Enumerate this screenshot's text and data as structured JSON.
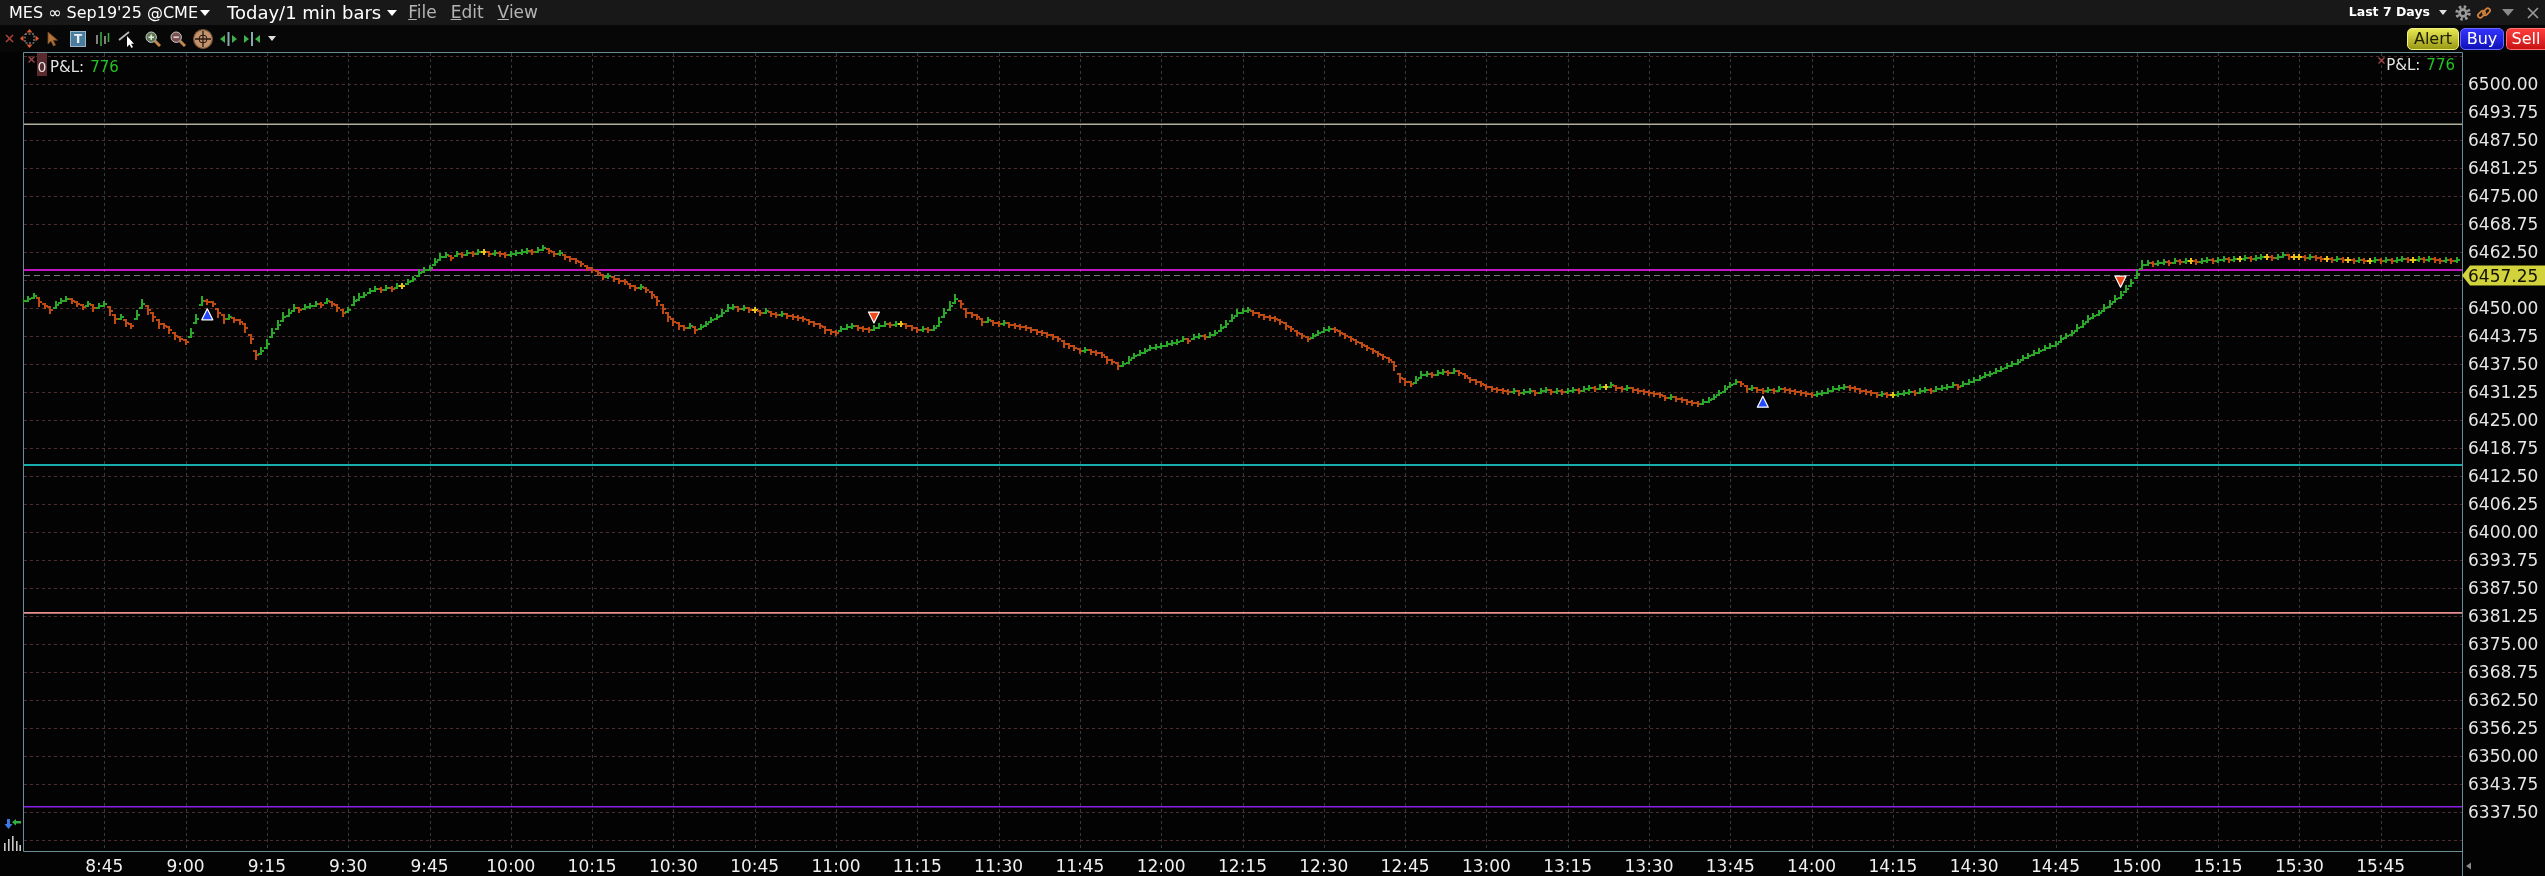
{
  "title_bar": {
    "instrument": "MES ∞ Sep19'25 @CME",
    "bar_setting": "Today/1 min bars",
    "menus": [
      "File",
      "Edit",
      "View"
    ],
    "date_range": "Last 7 Days"
  },
  "toolbar": {
    "text_tool": "T",
    "order_buttons": [
      {
        "kind": "alert",
        "label": "Alert"
      },
      {
        "kind": "buy",
        "label": "Buy"
      },
      {
        "kind": "sell",
        "label": "Sell"
      }
    ]
  },
  "chart": {
    "legend_left": {
      "badge": "0",
      "label": "P&L:",
      "value": "776"
    },
    "legend_right": {
      "label": "P&L:",
      "value": "776"
    },
    "chart_data": {
      "type": "scatter",
      "grid": true,
      "xlim": [
        510,
        960
      ],
      "ylim": [
        6328.875,
        6507.125
      ],
      "x": [
        510,
        511,
        512,
        513,
        514,
        515,
        516,
        517,
        518,
        519,
        520,
        521,
        522,
        523,
        524,
        525,
        526,
        527,
        528,
        529,
        530,
        531,
        532,
        533,
        534,
        535,
        536,
        537,
        538,
        539,
        540,
        541,
        542,
        543,
        544,
        545,
        546,
        547,
        548,
        549,
        550,
        551,
        552,
        553,
        554,
        555,
        556,
        557,
        558,
        559,
        560,
        561,
        562,
        563,
        564,
        565,
        566,
        567,
        568,
        569,
        570,
        571,
        572,
        573,
        574,
        575,
        576,
        577,
        578,
        579,
        580,
        581,
        582,
        583,
        584,
        585,
        586,
        587,
        588,
        589,
        590,
        591,
        592,
        593,
        594,
        595,
        596,
        597,
        598,
        599,
        600,
        601,
        602,
        603,
        604,
        605,
        606,
        607,
        608,
        609,
        610,
        611,
        612,
        613,
        614,
        615,
        616,
        617,
        618,
        619,
        620,
        621,
        622,
        623,
        624,
        625,
        626,
        627,
        628,
        629,
        630,
        631,
        632,
        633,
        634,
        635,
        636,
        637,
        638,
        639,
        640,
        641,
        642,
        643,
        644,
        645,
        646,
        647,
        648,
        649,
        650,
        651,
        652,
        653,
        654,
        655,
        656,
        657,
        658,
        659,
        660,
        661,
        662,
        663,
        664,
        665,
        666,
        667,
        668,
        669,
        670,
        671,
        672,
        673,
        674,
        675,
        676,
        677,
        678,
        679,
        680,
        681,
        682,
        683,
        684,
        685,
        686,
        687,
        688,
        689,
        690,
        691,
        692,
        693,
        694,
        695,
        696,
        697,
        698,
        699,
        700,
        701,
        702,
        703,
        704,
        705,
        706,
        707,
        708,
        709,
        710,
        711,
        712,
        713,
        714,
        715,
        716,
        717,
        718,
        719,
        720,
        721,
        722,
        723,
        724,
        725,
        726,
        727,
        728,
        729,
        730,
        731,
        732,
        733,
        734,
        735,
        736,
        737,
        738,
        739,
        740,
        741,
        742,
        743,
        744,
        745,
        746,
        747,
        748,
        749,
        750,
        751,
        752,
        753,
        754,
        755,
        756,
        757,
        758,
        759,
        760,
        761,
        762,
        763,
        764,
        765,
        766,
        767,
        768,
        769,
        770,
        771,
        772,
        773,
        774,
        775,
        776,
        777,
        778,
        779,
        780,
        781,
        782,
        783,
        784,
        785,
        786,
        787,
        788,
        789,
        790,
        791,
        792,
        793,
        794,
        795,
        796,
        797,
        798,
        799,
        800,
        801,
        802,
        803,
        804,
        805,
        806,
        807,
        808,
        809,
        810,
        811,
        812,
        813,
        814,
        815,
        816,
        817,
        818,
        819,
        820,
        821,
        822,
        823,
        824,
        825,
        826,
        827,
        828,
        829,
        830,
        831,
        832,
        833,
        834,
        835,
        836,
        837,
        838,
        839,
        840,
        841,
        842,
        843,
        844,
        845,
        846,
        847,
        848,
        849,
        850,
        851,
        852,
        853,
        854,
        855,
        856,
        857,
        858,
        859,
        860,
        861,
        862,
        863,
        864,
        865,
        866,
        867,
        868,
        869,
        870,
        871,
        872,
        873,
        874,
        875,
        876,
        877,
        878,
        879,
        880,
        881,
        882,
        883,
        884,
        885,
        886,
        887,
        888,
        889,
        890,
        891,
        892,
        893,
        894,
        895,
        896,
        897,
        898,
        899,
        900,
        901,
        902,
        903,
        904,
        905,
        906,
        907,
        908,
        909,
        910,
        911,
        912,
        913,
        914,
        915,
        916,
        917,
        918,
        919,
        920,
        921,
        922,
        923,
        924,
        925,
        926,
        927,
        928,
        929,
        930,
        931,
        932,
        933,
        934,
        935,
        936,
        937,
        938,
        939,
        940,
        941,
        942,
        943,
        944,
        945,
        946,
        947,
        948,
        949,
        950,
        951,
        952,
        953,
        954,
        955,
        956,
        957,
        958,
        959
      ],
      "series": [
        {
          "values": [
            6451.5,
            6452,
            6452.75,
            6451.25,
            6450.5,
            6449.5,
            6450.75,
            6451.5,
            6452,
            6451.5,
            6451,
            6450.25,
            6451,
            6450,
            6450.5,
            6451,
            6449.25,
            6447.5,
            6448,
            6446.75,
            6446,
            6448.5,
            6451,
            6449.5,
            6448,
            6446.5,
            6446,
            6445,
            6443.75,
            6443,
            6442.5,
            6444.5,
            6447.5,
            6451.5,
            6451.25,
            6451,
            6449,
            6447.5,
            6448,
            6447.25,
            6447,
            6445.5,
            6443,
            6439.5,
            6440.5,
            6442,
            6444.5,
            6446.25,
            6448,
            6449,
            6450,
            6449.5,
            6450.25,
            6450.5,
            6451,
            6450.75,
            6451.5,
            6451,
            6450,
            6449,
            6449.5,
            6451.5,
            6452.5,
            6453,
            6453.75,
            6454.25,
            6454,
            6454.5,
            6454.25,
            6455,
            6455,
            6455.75,
            6456.5,
            6457.75,
            6458.5,
            6459,
            6460.25,
            6461.5,
            6461.75,
            6461.25,
            6462,
            6461.75,
            6462.25,
            6462,
            6462.5,
            6462.5,
            6462,
            6462.25,
            6462,
            6461.75,
            6462,
            6462.25,
            6462.5,
            6462.75,
            6462.5,
            6463,
            6463.5,
            6462.75,
            6462,
            6462.25,
            6461.5,
            6461,
            6460.5,
            6459.75,
            6459,
            6458.5,
            6457.75,
            6457,
            6457.25,
            6456.5,
            6456,
            6455.75,
            6455,
            6454.5,
            6454.75,
            6454,
            6453,
            6451.5,
            6449.75,
            6448,
            6447,
            6446,
            6445.5,
            6446,
            6445,
            6445.75,
            6446.5,
            6447.25,
            6448,
            6449,
            6450,
            6450.25,
            6449.75,
            6450,
            6449.5,
            6449.5,
            6449,
            6449.25,
            6448.75,
            6448.5,
            6448.75,
            6448.25,
            6448,
            6447.75,
            6447.5,
            6447,
            6446.5,
            6446,
            6445,
            6444.75,
            6444.5,
            6445.25,
            6445.75,
            6446,
            6445.5,
            6445.25,
            6445,
            6445.5,
            6446,
            6446.5,
            6446.25,
            6446.5,
            6446.5,
            6446,
            6445.5,
            6445,
            6445.25,
            6445,
            6445.5,
            6447,
            6449,
            6450.5,
            6452,
            6451,
            6449,
            6448.5,
            6448,
            6447,
            6447.25,
            6446.75,
            6446.5,
            6446.75,
            6446.25,
            6446,
            6445.75,
            6445.5,
            6445,
            6444.75,
            6444.5,
            6444,
            6443.5,
            6443,
            6442,
            6441.5,
            6441,
            6440.5,
            6440.75,
            6440.25,
            6440,
            6439.5,
            6438.5,
            6438,
            6437,
            6437.5,
            6438.5,
            6439.25,
            6440,
            6440.5,
            6441,
            6441.25,
            6441.5,
            6442,
            6442.25,
            6442.5,
            6443,
            6442.75,
            6443.5,
            6443.75,
            6443.5,
            6444,
            6444.5,
            6445.5,
            6446.5,
            6447.75,
            6449,
            6449.25,
            6449.5,
            6449,
            6448.5,
            6448,
            6447.75,
            6447.5,
            6447,
            6446,
            6445.25,
            6444.5,
            6443.75,
            6443,
            6443.75,
            6444.5,
            6445,
            6445.25,
            6445,
            6444.5,
            6443.75,
            6443,
            6442.5,
            6441.75,
            6441,
            6440.5,
            6439.75,
            6439,
            6438.5,
            6437,
            6434.5,
            6433.5,
            6433,
            6434,
            6435,
            6435.25,
            6435,
            6435.5,
            6435.75,
            6435.5,
            6436,
            6435.5,
            6434.75,
            6434,
            6433.5,
            6433,
            6432.5,
            6432,
            6431.75,
            6431.5,
            6431.25,
            6431.5,
            6431,
            6431.25,
            6431.5,
            6431,
            6431.5,
            6431.75,
            6431.25,
            6431.5,
            6431.25,
            6431.5,
            6431.75,
            6431.5,
            6432,
            6432.25,
            6432,
            6432.5,
            6432.5,
            6432.75,
            6432.25,
            6432,
            6432.25,
            6431.75,
            6431.5,
            6431.25,
            6431,
            6430.75,
            6430.5,
            6430,
            6430.25,
            6429.75,
            6429.5,
            6429,
            6428.75,
            6428.5,
            6429,
            6429.5,
            6430.25,
            6431,
            6432,
            6432.75,
            6433.5,
            6433,
            6432,
            6432.25,
            6431.75,
            6431.5,
            6431.75,
            6431.5,
            6432,
            6431.75,
            6431.5,
            6431.25,
            6431,
            6430.75,
            6430.5,
            6430.75,
            6431,
            6431.5,
            6432,
            6432.25,
            6432.5,
            6432.25,
            6432,
            6431.5,
            6431.25,
            6431,
            6430.5,
            6430.75,
            6430.5,
            6430.5,
            6430.75,
            6431,
            6431.25,
            6431,
            6431.5,
            6431.75,
            6431.5,
            6432,
            6432.25,
            6432.5,
            6432.75,
            6432.5,
            6433,
            6433.5,
            6434,
            6434.5,
            6435,
            6435.25,
            6436,
            6436.5,
            6437,
            6437.5,
            6438,
            6438.75,
            6439.25,
            6440,
            6440.5,
            6441,
            6441.5,
            6442,
            6443,
            6443.75,
            6444.5,
            6445.5,
            6446.5,
            6447.5,
            6448.25,
            6449,
            6450,
            6451,
            6452,
            6453,
            6454.25,
            6455.5,
            6457.5,
            6459.5,
            6460,
            6459.75,
            6460,
            6460.25,
            6460,
            6460.5,
            6460.25,
            6460.5,
            6460.5,
            6460.25,
            6460.5,
            6460.75,
            6460.5,
            6460.75,
            6461,
            6460.75,
            6461,
            6461,
            6461.25,
            6461,
            6461.25,
            6461.5,
            6461.5,
            6461.25,
            6461.5,
            6461.75,
            6461.5,
            6461.5,
            6461.5,
            6461.25,
            6461.5,
            6461.25,
            6461,
            6461,
            6460.75,
            6461,
            6460.75,
            6460.75,
            6460.5,
            6460.75,
            6460.5,
            6460.5,
            6460.75,
            6460.5,
            6460.75,
            6460.5,
            6460.75,
            6461,
            6460.75,
            6460.75,
            6461,
            6460.75,
            6461,
            6460.75,
            6460.5,
            6460.75,
            6460.5,
            6460.75
          ],
          "colors": [
            "#2aa82a",
            "#2aa82a",
            "#2aa82a",
            "#c04a14",
            "#c04a14",
            "#c04a14",
            "#2aa82a",
            "#2aa82a",
            "#2aa82a",
            "#c04a14",
            "#c04a14",
            "#c04a14",
            "#2aa82a",
            "#c04a14",
            "#2aa82a",
            "#2aa82a",
            "#c04a14",
            "#c04a14",
            "#2aa82a",
            "#c04a14",
            "#c04a14",
            "#2aa82a",
            "#2aa82a",
            "#c04a14",
            "#c04a14",
            "#c04a14",
            "#c04a14",
            "#c04a14",
            "#c04a14",
            "#c04a14",
            "#c04a14",
            "#2aa82a",
            "#2aa82a",
            "#2aa82a",
            "#c04a14",
            "#c04a14",
            "#c04a14",
            "#c04a14",
            "#2aa82a",
            "#c04a14",
            "#c04a14",
            "#c04a14",
            "#c04a14",
            "#c04a14",
            "#2aa82a",
            "#2aa82a",
            "#2aa82a",
            "#2aa82a",
            "#2aa82a",
            "#2aa82a",
            "#2aa82a",
            "#c04a14",
            "#2aa82a",
            "#2aa82a",
            "#2aa82a",
            "#c04a14",
            "#2aa82a",
            "#c04a14",
            "#c04a14",
            "#c04a14",
            "#2aa82a",
            "#2aa82a",
            "#2aa82a",
            "#2aa82a",
            "#2aa82a",
            "#2aa82a",
            "#c04a14",
            "#2aa82a",
            "#c04a14",
            "#2aa82a",
            "#e8c418",
            "#2aa82a",
            "#2aa82a",
            "#2aa82a",
            "#2aa82a",
            "#2aa82a",
            "#2aa82a",
            "#2aa82a",
            "#2aa82a",
            "#c04a14",
            "#2aa82a",
            "#c04a14",
            "#2aa82a",
            "#c04a14",
            "#2aa82a",
            "#e8c418",
            "#c04a14",
            "#2aa82a",
            "#c04a14",
            "#c04a14",
            "#2aa82a",
            "#2aa82a",
            "#2aa82a",
            "#2aa82a",
            "#c04a14",
            "#2aa82a",
            "#2aa82a",
            "#c04a14",
            "#c04a14",
            "#2aa82a",
            "#c04a14",
            "#c04a14",
            "#c04a14",
            "#c04a14",
            "#c04a14",
            "#c04a14",
            "#c04a14",
            "#c04a14",
            "#2aa82a",
            "#c04a14",
            "#c04a14",
            "#c04a14",
            "#c04a14",
            "#c04a14",
            "#2aa82a",
            "#c04a14",
            "#c04a14",
            "#c04a14",
            "#c04a14",
            "#c04a14",
            "#c04a14",
            "#c04a14",
            "#c04a14",
            "#2aa82a",
            "#c04a14",
            "#2aa82a",
            "#2aa82a",
            "#2aa82a",
            "#2aa82a",
            "#2aa82a",
            "#2aa82a",
            "#2aa82a",
            "#c04a14",
            "#2aa82a",
            "#c04a14",
            "#e8c418",
            "#c04a14",
            "#2aa82a",
            "#c04a14",
            "#c04a14",
            "#2aa82a",
            "#c04a14",
            "#c04a14",
            "#c04a14",
            "#c04a14",
            "#c04a14",
            "#c04a14",
            "#c04a14",
            "#c04a14",
            "#c04a14",
            "#c04a14",
            "#2aa82a",
            "#2aa82a",
            "#2aa82a",
            "#c04a14",
            "#c04a14",
            "#c04a14",
            "#2aa82a",
            "#2aa82a",
            "#2aa82a",
            "#c04a14",
            "#2aa82a",
            "#e8c418",
            "#c04a14",
            "#c04a14",
            "#c04a14",
            "#2aa82a",
            "#c04a14",
            "#2aa82a",
            "#2aa82a",
            "#2aa82a",
            "#2aa82a",
            "#2aa82a",
            "#c04a14",
            "#c04a14",
            "#c04a14",
            "#c04a14",
            "#c04a14",
            "#2aa82a",
            "#c04a14",
            "#c04a14",
            "#2aa82a",
            "#c04a14",
            "#c04a14",
            "#c04a14",
            "#c04a14",
            "#c04a14",
            "#c04a14",
            "#c04a14",
            "#c04a14",
            "#c04a14",
            "#c04a14",
            "#c04a14",
            "#c04a14",
            "#c04a14",
            "#c04a14",
            "#2aa82a",
            "#c04a14",
            "#c04a14",
            "#c04a14",
            "#c04a14",
            "#c04a14",
            "#c04a14",
            "#2aa82a",
            "#2aa82a",
            "#2aa82a",
            "#2aa82a",
            "#2aa82a",
            "#2aa82a",
            "#2aa82a",
            "#2aa82a",
            "#2aa82a",
            "#2aa82a",
            "#2aa82a",
            "#2aa82a",
            "#c04a14",
            "#2aa82a",
            "#2aa82a",
            "#c04a14",
            "#2aa82a",
            "#2aa82a",
            "#2aa82a",
            "#2aa82a",
            "#2aa82a",
            "#2aa82a",
            "#2aa82a",
            "#2aa82a",
            "#c04a14",
            "#c04a14",
            "#c04a14",
            "#c04a14",
            "#c04a14",
            "#c04a14",
            "#c04a14",
            "#c04a14",
            "#c04a14",
            "#c04a14",
            "#c04a14",
            "#2aa82a",
            "#2aa82a",
            "#2aa82a",
            "#2aa82a",
            "#c04a14",
            "#c04a14",
            "#c04a14",
            "#c04a14",
            "#c04a14",
            "#c04a14",
            "#c04a14",
            "#c04a14",
            "#c04a14",
            "#c04a14",
            "#c04a14",
            "#c04a14",
            "#c04a14",
            "#c04a14",
            "#c04a14",
            "#2aa82a",
            "#2aa82a",
            "#2aa82a",
            "#c04a14",
            "#2aa82a",
            "#2aa82a",
            "#c04a14",
            "#2aa82a",
            "#c04a14",
            "#c04a14",
            "#c04a14",
            "#c04a14",
            "#c04a14",
            "#c04a14",
            "#c04a14",
            "#c04a14",
            "#c04a14",
            "#c04a14",
            "#2aa82a",
            "#c04a14",
            "#2aa82a",
            "#2aa82a",
            "#c04a14",
            "#2aa82a",
            "#2aa82a",
            "#c04a14",
            "#2aa82a",
            "#c04a14",
            "#2aa82a",
            "#2aa82a",
            "#c04a14",
            "#2aa82a",
            "#2aa82a",
            "#c04a14",
            "#2aa82a",
            "#e8c418",
            "#2aa82a",
            "#c04a14",
            "#c04a14",
            "#2aa82a",
            "#c04a14",
            "#c04a14",
            "#c04a14",
            "#c04a14",
            "#c04a14",
            "#c04a14",
            "#c04a14",
            "#2aa82a",
            "#c04a14",
            "#c04a14",
            "#c04a14",
            "#c04a14",
            "#c04a14",
            "#2aa82a",
            "#2aa82a",
            "#2aa82a",
            "#2aa82a",
            "#2aa82a",
            "#2aa82a",
            "#2aa82a",
            "#c04a14",
            "#c04a14",
            "#2aa82a",
            "#c04a14",
            "#c04a14",
            "#2aa82a",
            "#c04a14",
            "#2aa82a",
            "#c04a14",
            "#c04a14",
            "#c04a14",
            "#c04a14",
            "#c04a14",
            "#c04a14",
            "#2aa82a",
            "#2aa82a",
            "#2aa82a",
            "#2aa82a",
            "#2aa82a",
            "#2aa82a",
            "#c04a14",
            "#c04a14",
            "#c04a14",
            "#c04a14",
            "#c04a14",
            "#c04a14",
            "#2aa82a",
            "#c04a14",
            "#e8c418",
            "#2aa82a",
            "#2aa82a",
            "#2aa82a",
            "#c04a14",
            "#2aa82a",
            "#2aa82a",
            "#c04a14",
            "#2aa82a",
            "#2aa82a",
            "#2aa82a",
            "#2aa82a",
            "#c04a14",
            "#2aa82a",
            "#2aa82a",
            "#2aa82a",
            "#2aa82a",
            "#2aa82a",
            "#2aa82a",
            "#2aa82a",
            "#2aa82a",
            "#2aa82a",
            "#2aa82a",
            "#2aa82a",
            "#2aa82a",
            "#2aa82a",
            "#2aa82a",
            "#2aa82a",
            "#2aa82a",
            "#2aa82a",
            "#2aa82a",
            "#2aa82a",
            "#2aa82a",
            "#2aa82a",
            "#2aa82a",
            "#2aa82a",
            "#2aa82a",
            "#2aa82a",
            "#2aa82a",
            "#2aa82a",
            "#2aa82a",
            "#2aa82a",
            "#2aa82a",
            "#2aa82a",
            "#2aa82a",
            "#2aa82a",
            "#2aa82a",
            "#2aa82a",
            "#c04a14",
            "#2aa82a",
            "#2aa82a",
            "#c04a14",
            "#2aa82a",
            "#c04a14",
            "#2aa82a",
            "#e8c418",
            "#c04a14",
            "#2aa82a",
            "#2aa82a",
            "#c04a14",
            "#2aa82a",
            "#2aa82a",
            "#c04a14",
            "#2aa82a",
            "#e8c418",
            "#2aa82a",
            "#c04a14",
            "#2aa82a",
            "#2aa82a",
            "#e8c418",
            "#c04a14",
            "#2aa82a",
            "#2aa82a",
            "#c04a14",
            "#e8c418",
            "#e8c418",
            "#c04a14",
            "#2aa82a",
            "#c04a14",
            "#c04a14",
            "#e8c418",
            "#c04a14",
            "#2aa82a",
            "#c04a14",
            "#e8c418",
            "#c04a14",
            "#2aa82a",
            "#c04a14",
            "#e8c418",
            "#2aa82a",
            "#c04a14",
            "#2aa82a",
            "#c04a14",
            "#2aa82a",
            "#2aa82a",
            "#c04a14",
            "#e8c418",
            "#2aa82a",
            "#c04a14",
            "#2aa82a",
            "#c04a14",
            "#c04a14",
            "#2aa82a",
            "#c04a14",
            "#2aa82a"
          ]
        },
        {
          "marker": "triangle-up",
          "color": "#2448ff",
          "x": [
            544,
            831
          ],
          "values": [
            6448.5,
            6429
          ]
        },
        {
          "marker": "triangle-down",
          "color": "#f04a1c",
          "x": [
            667,
            897
          ],
          "values": [
            6448,
            6456
          ]
        }
      ],
      "xticks": [
        {
          "value": 525,
          "label": "8:45"
        },
        {
          "value": 540,
          "label": "9:00"
        },
        {
          "value": 555,
          "label": "9:15"
        },
        {
          "value": 570,
          "label": "9:30"
        },
        {
          "value": 585,
          "label": "9:45"
        },
        {
          "value": 600,
          "label": "10:00"
        },
        {
          "value": 615,
          "label": "10:15"
        },
        {
          "value": 630,
          "label": "10:30"
        },
        {
          "value": 645,
          "label": "10:45"
        },
        {
          "value": 660,
          "label": "11:00"
        },
        {
          "value": 675,
          "label": "11:15"
        },
        {
          "value": 690,
          "label": "11:30"
        },
        {
          "value": 705,
          "label": "11:45"
        },
        {
          "value": 720,
          "label": "12:00"
        },
        {
          "value": 735,
          "label": "12:15"
        },
        {
          "value": 750,
          "label": "12:30"
        },
        {
          "value": 765,
          "label": "12:45"
        },
        {
          "value": 780,
          "label": "13:00"
        },
        {
          "value": 795,
          "label": "13:15"
        },
        {
          "value": 810,
          "label": "13:30"
        },
        {
          "value": 825,
          "label": "13:45"
        },
        {
          "value": 840,
          "label": "14:00"
        },
        {
          "value": 855,
          "label": "14:15"
        },
        {
          "value": 870,
          "label": "14:30"
        },
        {
          "value": 885,
          "label": "14:45"
        },
        {
          "value": 900,
          "label": "15:00"
        },
        {
          "value": 915,
          "label": "15:15"
        },
        {
          "value": 930,
          "label": "15:30"
        },
        {
          "value": 945,
          "label": "15:45"
        }
      ],
      "yticks": [
        {
          "value": 6337.5,
          "label": "6337.50"
        },
        {
          "value": 6343.75,
          "label": "6343.75"
        },
        {
          "value": 6350,
          "label": "6350.00"
        },
        {
          "value": 6356.25,
          "label": "6356.25"
        },
        {
          "value": 6362.5,
          "label": "6362.50"
        },
        {
          "value": 6368.75,
          "label": "6368.75"
        },
        {
          "value": 6375,
          "label": "6375.00"
        },
        {
          "value": 6381.25,
          "label": "6381.25"
        },
        {
          "value": 6387.5,
          "label": "6387.50"
        },
        {
          "value": 6393.75,
          "label": "6393.75"
        },
        {
          "value": 6400,
          "label": "6400.00"
        },
        {
          "value": 6406.25,
          "label": "6406.25"
        },
        {
          "value": 6412.5,
          "label": "6412.50"
        },
        {
          "value": 6418.75,
          "label": "6418.75"
        },
        {
          "value": 6425,
          "label": "6425.00"
        },
        {
          "value": 6431.25,
          "label": "6431.25"
        },
        {
          "value": 6437.5,
          "label": "6437.50"
        },
        {
          "value": 6443.75,
          "label": "6443.75"
        },
        {
          "value": 6450,
          "label": "6450.00"
        },
        {
          "value": 6462.5,
          "label": "6462.50"
        },
        {
          "value": 6468.75,
          "label": "6468.75"
        },
        {
          "value": 6475,
          "label": "6475.00"
        },
        {
          "value": 6481.25,
          "label": "6481.25"
        },
        {
          "value": 6487.5,
          "label": "6487.50"
        },
        {
          "value": 6493.75,
          "label": "6493.75"
        },
        {
          "value": 6500,
          "label": "6500.00"
        }
      ],
      "ref_lines": [
        {
          "axis": "y",
          "value": 6491,
          "color": "#b0b09a"
        },
        {
          "axis": "y",
          "value": 6458.5,
          "color": "#ff1eff"
        },
        {
          "axis": "y",
          "value": 6457.25,
          "color": "#7c7c7c",
          "label": "6457.25"
        },
        {
          "axis": "y",
          "value": 6415,
          "color": "#1ee6e6"
        },
        {
          "axis": "y",
          "value": 6382,
          "color": "#e89090"
        },
        {
          "axis": "y",
          "value": 6338.75,
          "color": "#8a1ee6"
        }
      ]
    }
  }
}
